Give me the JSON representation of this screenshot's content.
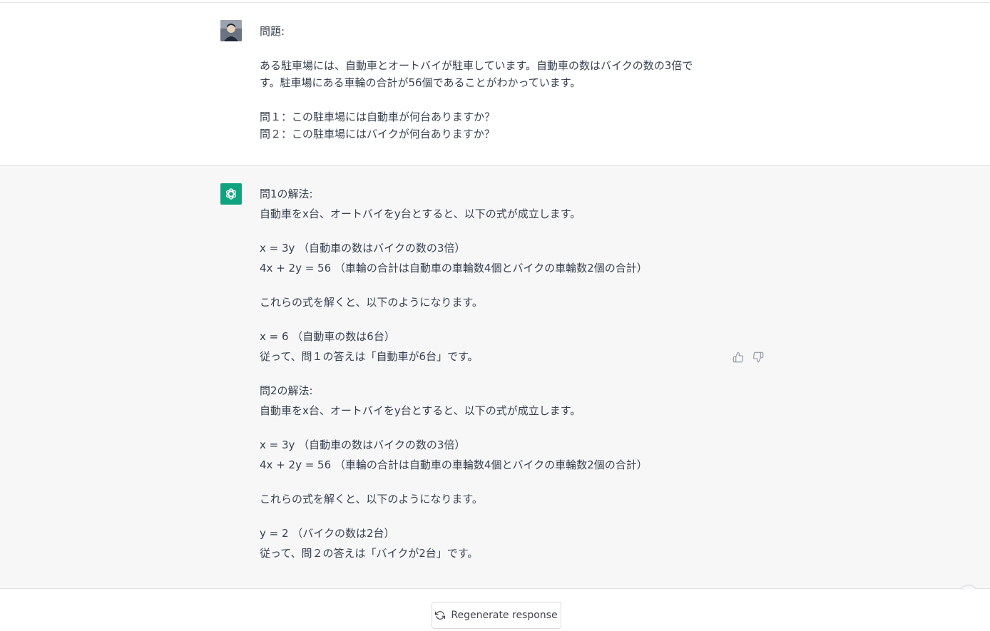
{
  "user_message": {
    "lines": [
      "問題:",
      "",
      "ある駐車場には、自動車とオートバイが駐車しています。自動車の数はバイクの数の3倍で",
      "す。駐車場にある車輪の合計が56個であることがわかっています。",
      "",
      "問１：この駐車場には自動車が何台ありますか？",
      "問２：この駐車場にはバイクが何台ありますか？"
    ]
  },
  "assistant_message": {
    "lines": [
      "問1の解法:",
      "自動車をx台、オートバイをy台とすると、以下の式が成立します。",
      "",
      "x = 3y （自動車の数はバイクの数の3倍）",
      "4x + 2y = 56 （車輪の合計は自動車の車輪数4個とバイクの車輪数2個の合計）",
      "",
      "これらの式を解くと、以下のようになります。",
      "",
      "x = 6 （自動車の数は6台）",
      "従って、問１の答えは「自動車が6台」です。",
      "",
      "問2の解法:",
      "自動車をx台、オートバイをy台とすると、以下の式が成立します。",
      "",
      "x = 3y （自動車の数はバイクの数の3倍）",
      "4x + 2y = 56 （車輪の合計は自動車の車輪数4個とバイクの車輪数2個の合計）",
      "",
      "これらの式を解くと、以下のようになります。",
      "",
      "y = 2 （バイクの数は2台）",
      "従って、問２の答えは「バイクが2台」です。"
    ]
  },
  "feedback": {
    "thumbs_up_icon": "thumbs-up-icon",
    "thumbs_down_icon": "thumbs-down-icon"
  },
  "regenerate": {
    "label": "Regenerate response",
    "icon": "refresh-icon"
  },
  "scroll": {
    "icon": "arrow-down-icon"
  },
  "colors": {
    "assistant_bg": "#f7f7f8",
    "bot_avatar": "#10a37f",
    "text": "#374151"
  }
}
